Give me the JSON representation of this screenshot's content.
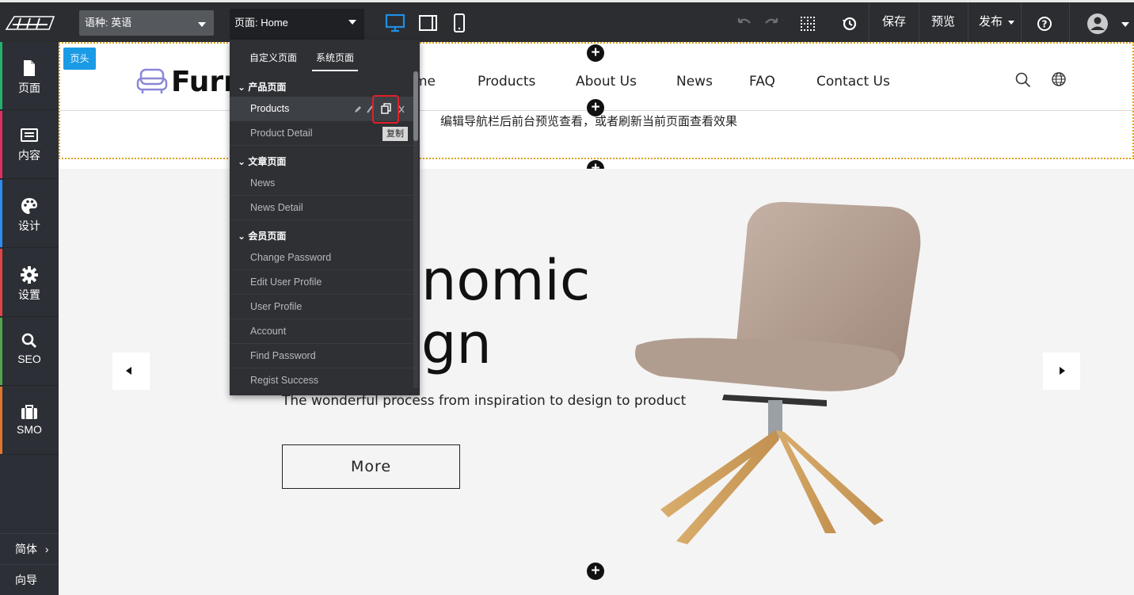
{
  "topbar": {
    "lang_label": "语种: 英语",
    "page_label": "页面: Home",
    "save": "保存",
    "preview": "预览",
    "publish": "发布"
  },
  "sidebar": {
    "items": [
      {
        "label": "页面",
        "icon": "page-icon",
        "color": "#23b26b"
      },
      {
        "label": "内容",
        "icon": "content-icon",
        "color": "#e0305f"
      },
      {
        "label": "设计",
        "icon": "palette-icon",
        "color": "#2d8cf0"
      },
      {
        "label": "设置",
        "icon": "gear-icon",
        "color": "#e04444"
      },
      {
        "label": "SEO",
        "icon": "search-icon",
        "color": "#52a54b"
      },
      {
        "label": "SMO",
        "icon": "briefcase-icon",
        "color": "#e0752d"
      }
    ],
    "lang_switch": "简体",
    "guide": "向导"
  },
  "canvas": {
    "head_tag": "页头",
    "logo_text": "Furn",
    "nav": [
      "me",
      "Products",
      "About Us",
      "News",
      "FAQ",
      "Contact Us"
    ],
    "notice": "编辑导航栏后前台预览查看，或者刷新当前页面查看效果",
    "hero_line1": "nomic",
    "hero_line2": "gn",
    "hero_sub": "The wonderful process from inspiration to design to product",
    "more": "More"
  },
  "dropdown": {
    "tabs": [
      "自定义页面",
      "系统页面"
    ],
    "groups": [
      {
        "title": "产品页面",
        "items": [
          "Products",
          "Product Detail"
        ]
      },
      {
        "title": "文章页面",
        "items": [
          "News",
          "News Detail"
        ]
      },
      {
        "title": "会员页面",
        "items": [
          "Change Password",
          "Edit User Profile",
          "User Profile",
          "Account",
          "Find Password",
          "Regist Success"
        ]
      }
    ],
    "tooltip": "复制"
  },
  "colors": {
    "accent_blue": "#1a9be6",
    "highlight_red": "#e0202a",
    "header_outline": "#d9a21b"
  }
}
